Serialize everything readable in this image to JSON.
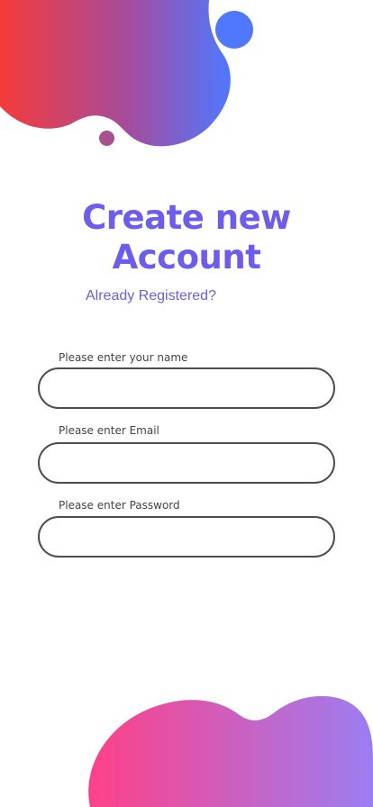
{
  "colors": {
    "accent": "#6c5cf0",
    "blob_top_start": "#f43b3b",
    "blob_top_mid": "#a64c9c",
    "blob_top_end": "#4f78ff",
    "dot_blue": "#4f78ff",
    "dot_purple": "#a9508f",
    "blob_bottom_start": "#ff4088",
    "blob_bottom_end": "#9b7ef2",
    "input_border": "#4d4d4d"
  },
  "header": {
    "title_line1": "Create new",
    "title_line2": "Account",
    "login_link": "Already Registered?"
  },
  "form": {
    "name": {
      "label": "Please enter your name",
      "value": "",
      "placeholder": ""
    },
    "email": {
      "label": "Please enter Email",
      "value": "",
      "placeholder": ""
    },
    "password": {
      "label": "Please enter Password",
      "value": "",
      "placeholder": ""
    }
  }
}
